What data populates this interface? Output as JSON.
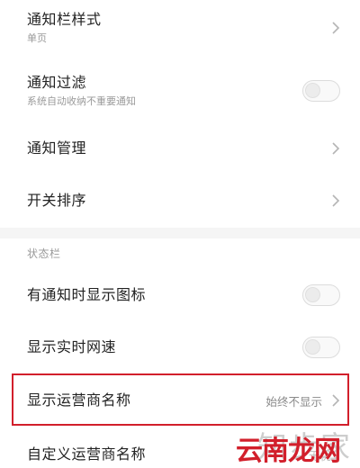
{
  "settings": {
    "notification_style": {
      "title": "通知栏样式",
      "subtitle": "单页"
    },
    "notification_filter": {
      "title": "通知过滤",
      "subtitle": "系统自动收纳不重要通知",
      "enabled": false
    },
    "notification_management": {
      "title": "通知管理"
    },
    "switch_order": {
      "title": "开关排序"
    },
    "status_bar_section": {
      "header": "状态栏"
    },
    "show_icon_on_notify": {
      "title": "有通知时显示图标",
      "enabled": false
    },
    "show_network_speed": {
      "title": "显示实时网速",
      "enabled": false
    },
    "show_carrier_name": {
      "title": "显示运营商名称",
      "value": "始终不显示"
    },
    "custom_carrier_name": {
      "title": "自定义运营商名称",
      "value": "无忧"
    }
  },
  "watermark": {
    "site": "知步家",
    "brand": "云南龙网"
  },
  "colors": {
    "highlight": "#d21f2b",
    "divider": "#f5f5f5",
    "secondary_text": "#9a9a9a"
  }
}
